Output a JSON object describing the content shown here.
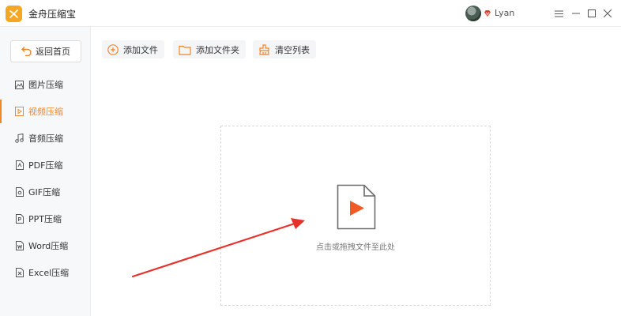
{
  "app": {
    "title": "金舟压缩宝",
    "username": "Lyan"
  },
  "sidebar": {
    "back_label": "返回首页",
    "items": [
      {
        "label": "图片压缩"
      },
      {
        "label": "视频压缩",
        "active": true
      },
      {
        "label": "音频压缩"
      },
      {
        "label": "PDF压缩"
      },
      {
        "label": "GIF压缩"
      },
      {
        "label": "PPT压缩"
      },
      {
        "label": "Word压缩"
      },
      {
        "label": "Excel压缩"
      }
    ]
  },
  "toolbar": {
    "add_file": "添加文件",
    "add_folder": "添加文件夹",
    "clear_list": "清空列表"
  },
  "dropzone": {
    "hint": "点击或拖拽文件至此处"
  },
  "colors": {
    "accent": "#f0862a",
    "play": "#f05a24",
    "arrow": "#e8312a"
  }
}
